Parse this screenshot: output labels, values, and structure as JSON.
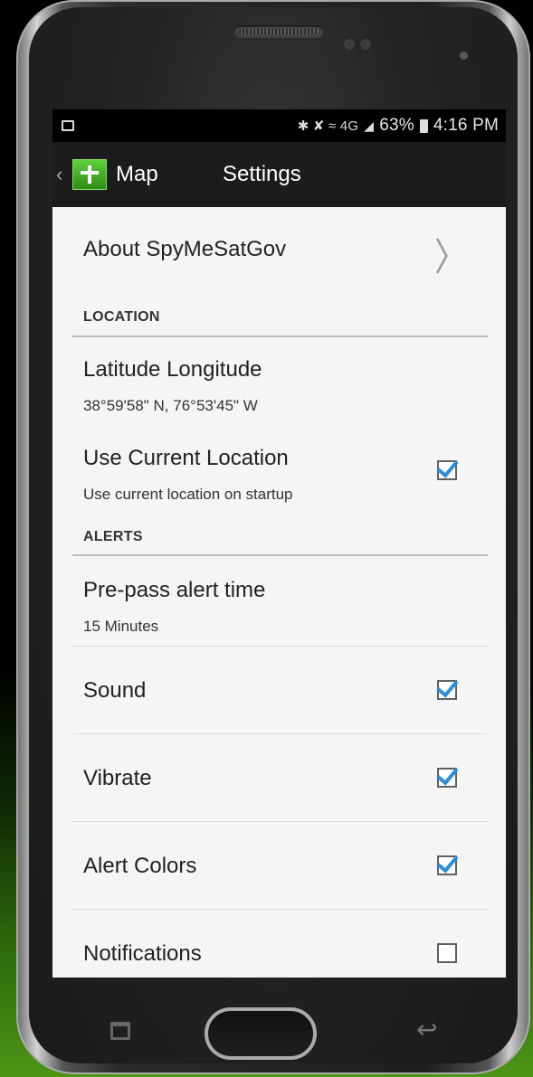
{
  "status_bar": {
    "icons": "✱ ✘ ≈ 4G",
    "battery": "63%",
    "time": "4:16 PM"
  },
  "action_bar": {
    "back_link": "Map",
    "title": "Settings"
  },
  "about": {
    "label": "About SpyMeSatGov",
    "icon": "chevron-right-icon"
  },
  "sections": {
    "location": "LOCATION",
    "alerts": "ALERTS"
  },
  "location": {
    "lat_long_title": "Latitude Longitude",
    "lat_long_value": "38°59'58\" N, 76°53'45\" W",
    "use_current_title": "Use Current Location",
    "use_current_sub": "Use current location on startup",
    "use_current_checked": true
  },
  "alerts": {
    "prepass_title": "Pre-pass alert time",
    "prepass_value": "15 Minutes",
    "items": [
      {
        "label": "Sound",
        "checked": true
      },
      {
        "label": "Vibrate",
        "checked": true
      },
      {
        "label": "Alert Colors",
        "checked": true
      },
      {
        "label": "Notifications",
        "checked": false
      }
    ]
  },
  "colors": {
    "screen_bg": "#f5f5f5",
    "action_bar": "#1c1c1c",
    "checkbox_accent": "#2a8fd9",
    "app_logo": "#3fae20"
  }
}
